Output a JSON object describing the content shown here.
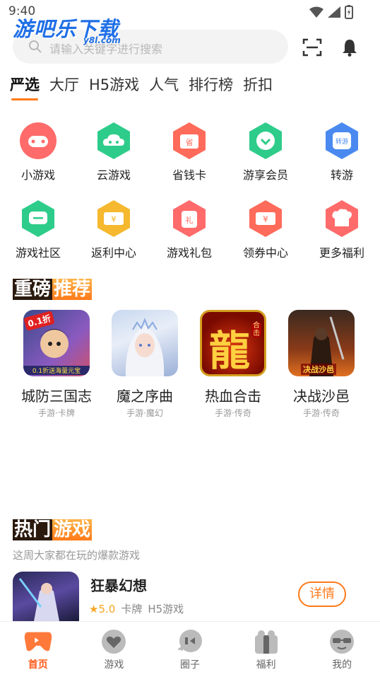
{
  "status": {
    "time": "9:40"
  },
  "logo": {
    "text": "游吧乐下载",
    "sub": "y8l.com"
  },
  "search": {
    "placeholder": "请输入关键字进行搜索"
  },
  "tabs": [
    {
      "label": "严选",
      "active": true
    },
    {
      "label": "大厅"
    },
    {
      "label": "H5游戏"
    },
    {
      "label": "人气"
    },
    {
      "label": "排行榜"
    },
    {
      "label": "折扣"
    }
  ],
  "grid": [
    {
      "label": "小游戏",
      "icon": "gamepad-icon",
      "color": "#ff6b6b"
    },
    {
      "label": "云游戏",
      "icon": "cloud-game-icon",
      "color": "#2ecc8a"
    },
    {
      "label": "省钱卡",
      "icon": "save-card-icon",
      "color": "#ff6b5a"
    },
    {
      "label": "游享会员",
      "icon": "vip-heart-icon",
      "color": "#2ecc8a"
    },
    {
      "label": "转游",
      "icon": "transfer-icon",
      "color": "#4a8af0"
    },
    {
      "label": "游戏社区",
      "icon": "chat-icon",
      "color": "#2ecc8a"
    },
    {
      "label": "返利中心",
      "icon": "rebate-ticket-icon",
      "color": "#f5b82e"
    },
    {
      "label": "游戏礼包",
      "icon": "gift-icon",
      "color": "#ff6b6b"
    },
    {
      "label": "领券中心",
      "icon": "coupon-icon",
      "color": "#ff6b5a"
    },
    {
      "label": "更多福利",
      "icon": "chef-hat-icon",
      "color": "#ff6b6b"
    }
  ],
  "featured": {
    "title_a": "重磅",
    "title_b": "推荐",
    "games": [
      {
        "name": "城防三国志",
        "sub": "手游·卡牌",
        "badge": "0.1折",
        "banner": "0.1折送海量元宝"
      },
      {
        "name": "魔之序曲",
        "sub": "手游·魔幻"
      },
      {
        "name": "热血合击",
        "sub": "手游·传奇",
        "glyph": "龍",
        "tag": "合击"
      },
      {
        "name": "决战沙邑",
        "sub": "手游·传奇",
        "banner": "决战沙邑"
      }
    ]
  },
  "hot": {
    "title_a": "热门",
    "title_b": "游戏",
    "subtitle": "这周大家都在玩的爆款游戏",
    "game": {
      "name": "狂暴幻想",
      "rating": "5.0",
      "tags": [
        "卡牌",
        "H5游戏"
      ],
      "button": "详情"
    }
  },
  "nav": [
    {
      "label": "首页",
      "active": true
    },
    {
      "label": "游戏"
    },
    {
      "label": "圈子"
    },
    {
      "label": "福利"
    },
    {
      "label": "我的"
    }
  ]
}
